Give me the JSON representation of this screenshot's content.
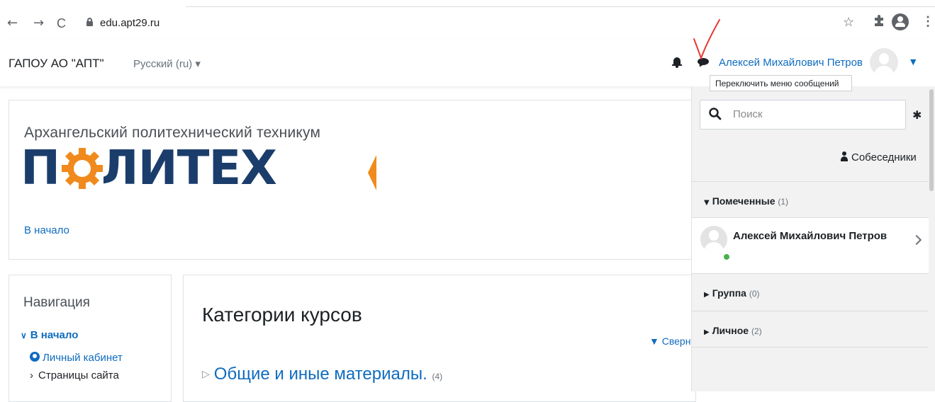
{
  "browser": {
    "back": "←",
    "forward": "→",
    "reload": "C",
    "url": "edu.apt29.ru",
    "star": "☆",
    "kebab": "⋮"
  },
  "navbar": {
    "site_name": "ГАПОУ АО \"АПТ\"",
    "language": "Русский (ru) ▾",
    "user_name": "Алексей Михайлович Петров",
    "user_caret": "▼"
  },
  "tooltip": "Переключить меню сообщений",
  "hero": {
    "logo_subtitle": "Архангельский политехнический техникум",
    "logo_word": "ПОЛИТЕХ",
    "home_link": "В начало"
  },
  "navigation": {
    "title": "Навигация",
    "home": "В начало",
    "cabinet": "Личный кабинет",
    "pages": "Страницы сайта"
  },
  "main": {
    "title": "Категории курсов",
    "collapse": "▼ Свернуть всё",
    "category": "Общие и иные материалы.",
    "category_count": "(4)"
  },
  "drawer": {
    "search_placeholder": "Поиск",
    "contacts": "Собеседники",
    "starred_label": "Помеченные",
    "starred_count": "(1)",
    "starred_contact": "Алексей Михайлович Петров",
    "group_label": "Группа",
    "group_count": "(0)",
    "private_label": "Личное",
    "private_count": "(2)"
  },
  "colors": {
    "link": "#0f6cbf",
    "logo_blue": "#1b3d6b",
    "logo_orange": "#f08a1c",
    "annotation": "#e53935",
    "online": "#4caf50"
  }
}
